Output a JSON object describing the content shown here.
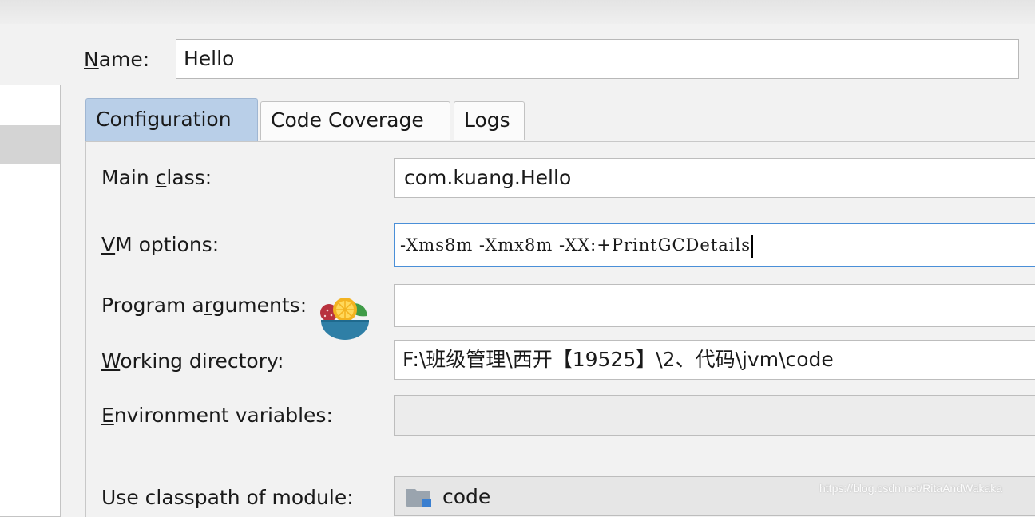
{
  "name": {
    "label_mnemonic": "N",
    "label_rest": "ame:",
    "value": "Hello"
  },
  "tabs": [
    {
      "label": "Configuration",
      "active": true
    },
    {
      "label": "Code Coverage",
      "active": false
    },
    {
      "label": "Logs",
      "active": false
    }
  ],
  "fields": {
    "main_class": {
      "label_before": "Main ",
      "label_mnemonic": "c",
      "label_after": "lass:",
      "value": "com.kuang.Hello"
    },
    "vm_options": {
      "label_before": "",
      "label_mnemonic": "V",
      "label_after": "M options:",
      "value": "-Xms8m -Xmx8m -XX:+PrintGCDetails"
    },
    "program_arguments": {
      "label_before": "Program a",
      "label_mnemonic": "r",
      "label_after": "guments:",
      "value": ""
    },
    "working_directory": {
      "label_before": "",
      "label_mnemonic": "W",
      "label_after": "orking directory:",
      "value": "F:\\班级管理\\西开【19525】\\2、代码\\jvm\\code"
    },
    "environment_variables": {
      "label_before": "",
      "label_mnemonic": "E",
      "label_after": "nvironment variables:",
      "value": ""
    },
    "classpath_module": {
      "label": "Use classpath of module:",
      "value": "code",
      "icon": "module-folder-icon"
    }
  },
  "overlay_icon": "salad-bowl-icon",
  "watermark": "https://blog.csdn.net/RitaAndWakaka",
  "colors": {
    "active_tab": "#b9cfe8",
    "focus_border": "#4a8fd8",
    "folder": "#9aa4ae"
  }
}
